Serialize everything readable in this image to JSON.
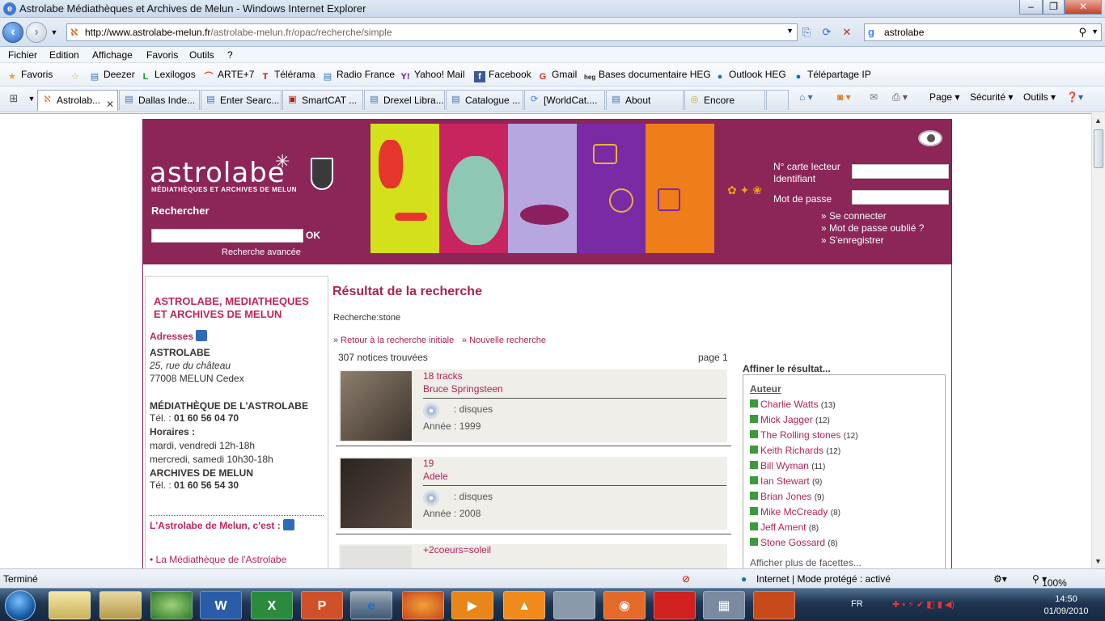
{
  "window": {
    "title": "Astrolabe Médiathèques et Archives de Melun - Windows Internet Explorer"
  },
  "address": {
    "url_host": "http://www.astrolabe-melun.fr",
    "url_path": "/astrolabe-melun.fr/opac/recherche/simple",
    "search_text": "astrolabe"
  },
  "menu": [
    "Fichier",
    "Edition",
    "Affichage",
    "Favoris",
    "Outils",
    "?"
  ],
  "favorites": {
    "label": "Favoris",
    "items": [
      "Deezer",
      "Lexilogos",
      "ARTE+7",
      "Télérama",
      "Radio France",
      "Yahoo! Mail",
      "Facebook",
      "Gmail",
      "Bases documentaire HEG",
      "Outlook HEG",
      "Télépartage IP"
    ]
  },
  "tabs": [
    "Astrolab...",
    "Dallas Inde...",
    "Enter Searc...",
    "SmartCAT ...",
    "Drexel Libra...",
    "Catalogue ...",
    "[WorldCat....",
    "About",
    "Encore"
  ],
  "commands": [
    "Page",
    "Sécurité",
    "Outils"
  ],
  "status": {
    "left": "Terminé",
    "zone": "Internet | Mode protégé : activé",
    "zoom": "100%"
  },
  "taskbar": {
    "lang": "FR",
    "time": "14:50",
    "date": "01/09/2010"
  },
  "banner": {
    "logo": "astrolabe",
    "logo_sub": "MÉDIATHÈQUES ET ARCHIVES DE MELUN",
    "search_label": "Rechercher",
    "ok": "OK",
    "advanced": "Recherche avancée",
    "card_label": "N° carte lecteur",
    "id_label": "Identifiant",
    "pwd_label": "Mot de passe",
    "connect": "» Se connecter",
    "forgot": "» Mot de passe oublié ?",
    "register": "» S'enregistrer"
  },
  "sidebar": {
    "title": "ASTROLABE, MEDIATHEQUES ET ARCHIVES DE MELUN",
    "addresses": "Adresses",
    "name": "ASTROLABE",
    "street": "25, rue du château",
    "city": "77008 MELUN Cedex",
    "med_title": "MÉDIATHÈQUE DE L'ASTROLABE",
    "tel_label": "Tél. :",
    "tel1": "01 60 56 04 70",
    "hours_title": "Horaires :",
    "hours1": "mardi, vendredi 12h-18h",
    "hours2": "mercredi, samedi 10h30-18h",
    "arch_title": "ARCHIVES DE MELUN",
    "tel2": "01 60 56 54 30",
    "cest": "L'Astrolabe de Melun, c'est :",
    "bullet": "• La Médiathèque de l'Astrolabe"
  },
  "results": {
    "title": "Résultat de la recherche",
    "query": "Recherche:stone",
    "back": "» Retour à la recherche initiale",
    "new": "» Nouvelle recherche",
    "count": "307 notices trouvées",
    "page": "page 1",
    "items": [
      {
        "title": "18 tracks",
        "author": "Bruce Springsteen",
        "type": ": disques",
        "year": "Année : 1999"
      },
      {
        "title": "19",
        "author": "Adele",
        "type": ": disques",
        "year": "Année : 2008"
      },
      {
        "title": "+2coeurs=soleil"
      }
    ]
  },
  "facets": {
    "title": "Affiner le résultat...",
    "group": "Auteur",
    "items": [
      {
        "name": "Charlie Watts",
        "count": "(13)"
      },
      {
        "name": "Mick Jagger",
        "count": "(12)"
      },
      {
        "name": "The Rolling stones",
        "count": "(12)"
      },
      {
        "name": "Keith Richards",
        "count": "(12)"
      },
      {
        "name": "Bill Wyman",
        "count": "(11)"
      },
      {
        "name": "Ian Stewart",
        "count": "(9)"
      },
      {
        "name": "Brian Jones",
        "count": "(9)"
      },
      {
        "name": "Mike McCready",
        "count": "(8)"
      },
      {
        "name": "Jeff Ament",
        "count": "(8)"
      },
      {
        "name": "Stone Gossard",
        "count": "(8)"
      }
    ],
    "more": "Afficher plus de facettes..."
  }
}
